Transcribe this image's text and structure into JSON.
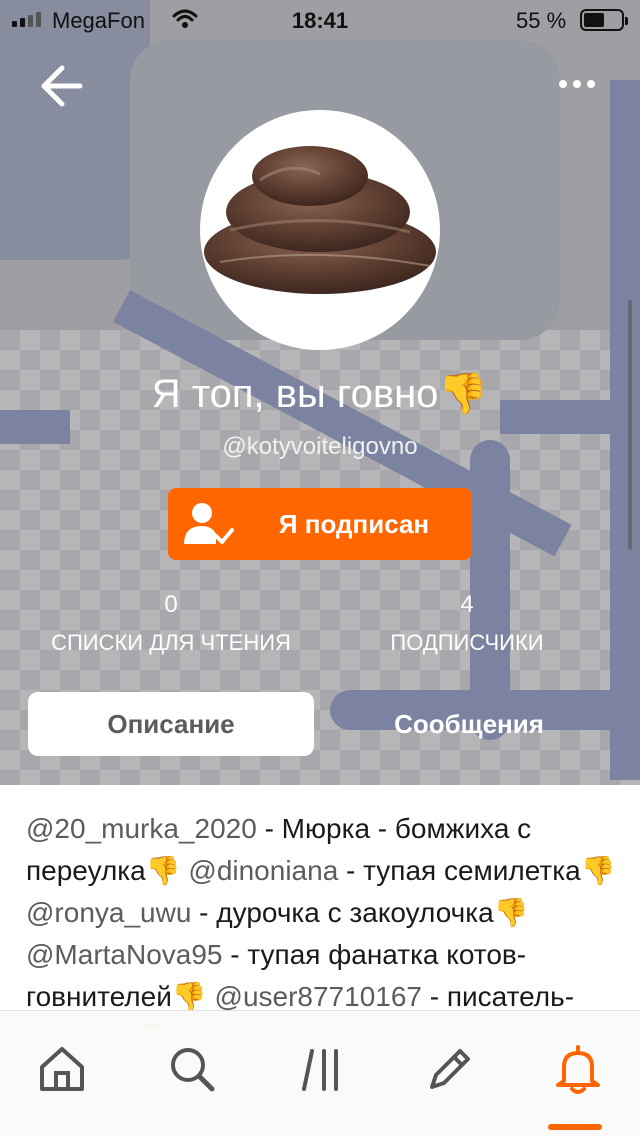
{
  "status_bar": {
    "carrier": "MegaFon",
    "time": "18:41",
    "battery": "55 %",
    "battery_level": 0.55
  },
  "profile": {
    "name": "Я топ, вы говно",
    "name_emoji": "👎",
    "handle": "@kotyvoiteligovno"
  },
  "subscribe_button": {
    "label": "Я подписан"
  },
  "stats": {
    "reading_lists": {
      "value": "0",
      "label": "СПИСКИ ДЛЯ ЧТЕНИЯ"
    },
    "followers": {
      "value": "4",
      "label": "ПОДПИСЧИКИ"
    }
  },
  "tabs": [
    {
      "label": "Описание",
      "active": true
    },
    {
      "label": "Сообщения",
      "active": false
    }
  ],
  "description": [
    {
      "mention": "@20_murka_2020",
      "text": " - Мюрка - бомжиха с переулка"
    },
    {
      "mention": "@dinoniana",
      "text": " - тупая семилетка"
    },
    {
      "mention": "@ronya_uwu",
      "text": " - дурочка с закоулочка"
    },
    {
      "mention": "@MartaNova95",
      "text": " - тупая фанатка котов-говнителей"
    },
    {
      "mention": "@user87710167",
      "text": " - писатель-рукожоп"
    }
  ],
  "emoji": "👎",
  "bottom_nav": [
    {
      "icon": "home-icon",
      "active": false
    },
    {
      "icon": "search-icon",
      "active": false
    },
    {
      "icon": "library-icon",
      "active": false
    },
    {
      "icon": "write-icon",
      "active": false
    },
    {
      "icon": "bell-icon",
      "active": true
    }
  ],
  "colors": {
    "accent": "#ff6600",
    "mention": "#5c5c5c",
    "text": "#1a1a1a"
  }
}
